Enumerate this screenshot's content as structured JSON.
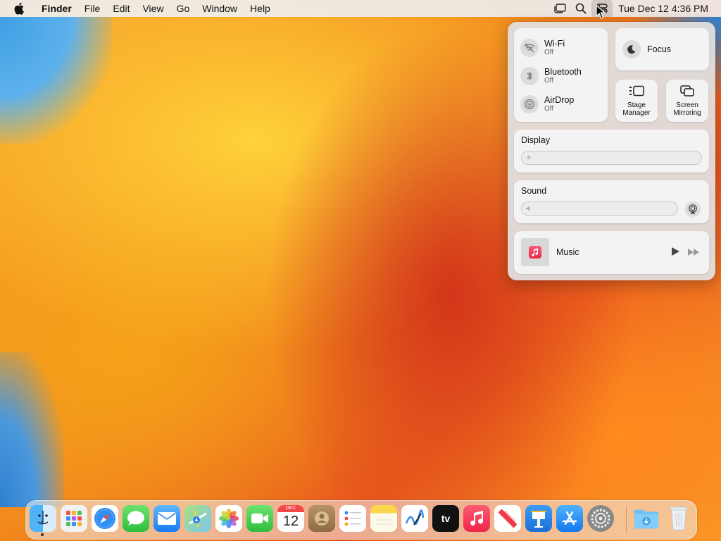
{
  "menubar": {
    "app_name": "Finder",
    "menus": [
      "File",
      "Edit",
      "View",
      "Go",
      "Window",
      "Help"
    ],
    "clock": "Tue Dec 12  4:36 PM",
    "icons": [
      "stage-manager-icon",
      "spotlight-search-icon",
      "control-center-icon"
    ]
  },
  "control_center": {
    "wifi": {
      "title": "Wi-Fi",
      "status": "Off"
    },
    "bluetooth": {
      "title": "Bluetooth",
      "status": "Off"
    },
    "airdrop": {
      "title": "AirDrop",
      "status": "Off"
    },
    "focus": {
      "title": "Focus"
    },
    "stage_manager": {
      "line1": "Stage",
      "line2": "Manager"
    },
    "screen_mirroring": {
      "line1": "Screen",
      "line2": "Mirroring"
    },
    "display": {
      "title": "Display",
      "level": 0
    },
    "sound": {
      "title": "Sound",
      "level": 0
    },
    "music": {
      "title": "Music"
    }
  },
  "dock": {
    "apps": [
      "Finder",
      "Launchpad",
      "Safari",
      "Messages",
      "Mail",
      "Maps",
      "Photos",
      "FaceTime",
      "Calendar",
      "Contacts",
      "Reminders",
      "Notes",
      "Freeform",
      "TV",
      "Music",
      "News",
      "Keynote",
      "App Store",
      "System Settings",
      "Downloads",
      "Trash"
    ],
    "calendar_month": "DEC",
    "calendar_day": "12",
    "tv_label": "tv"
  },
  "colors": {
    "accent": "#0a84ff",
    "music_red": "#f0254a",
    "panel_bg": "#e1e1e1"
  }
}
